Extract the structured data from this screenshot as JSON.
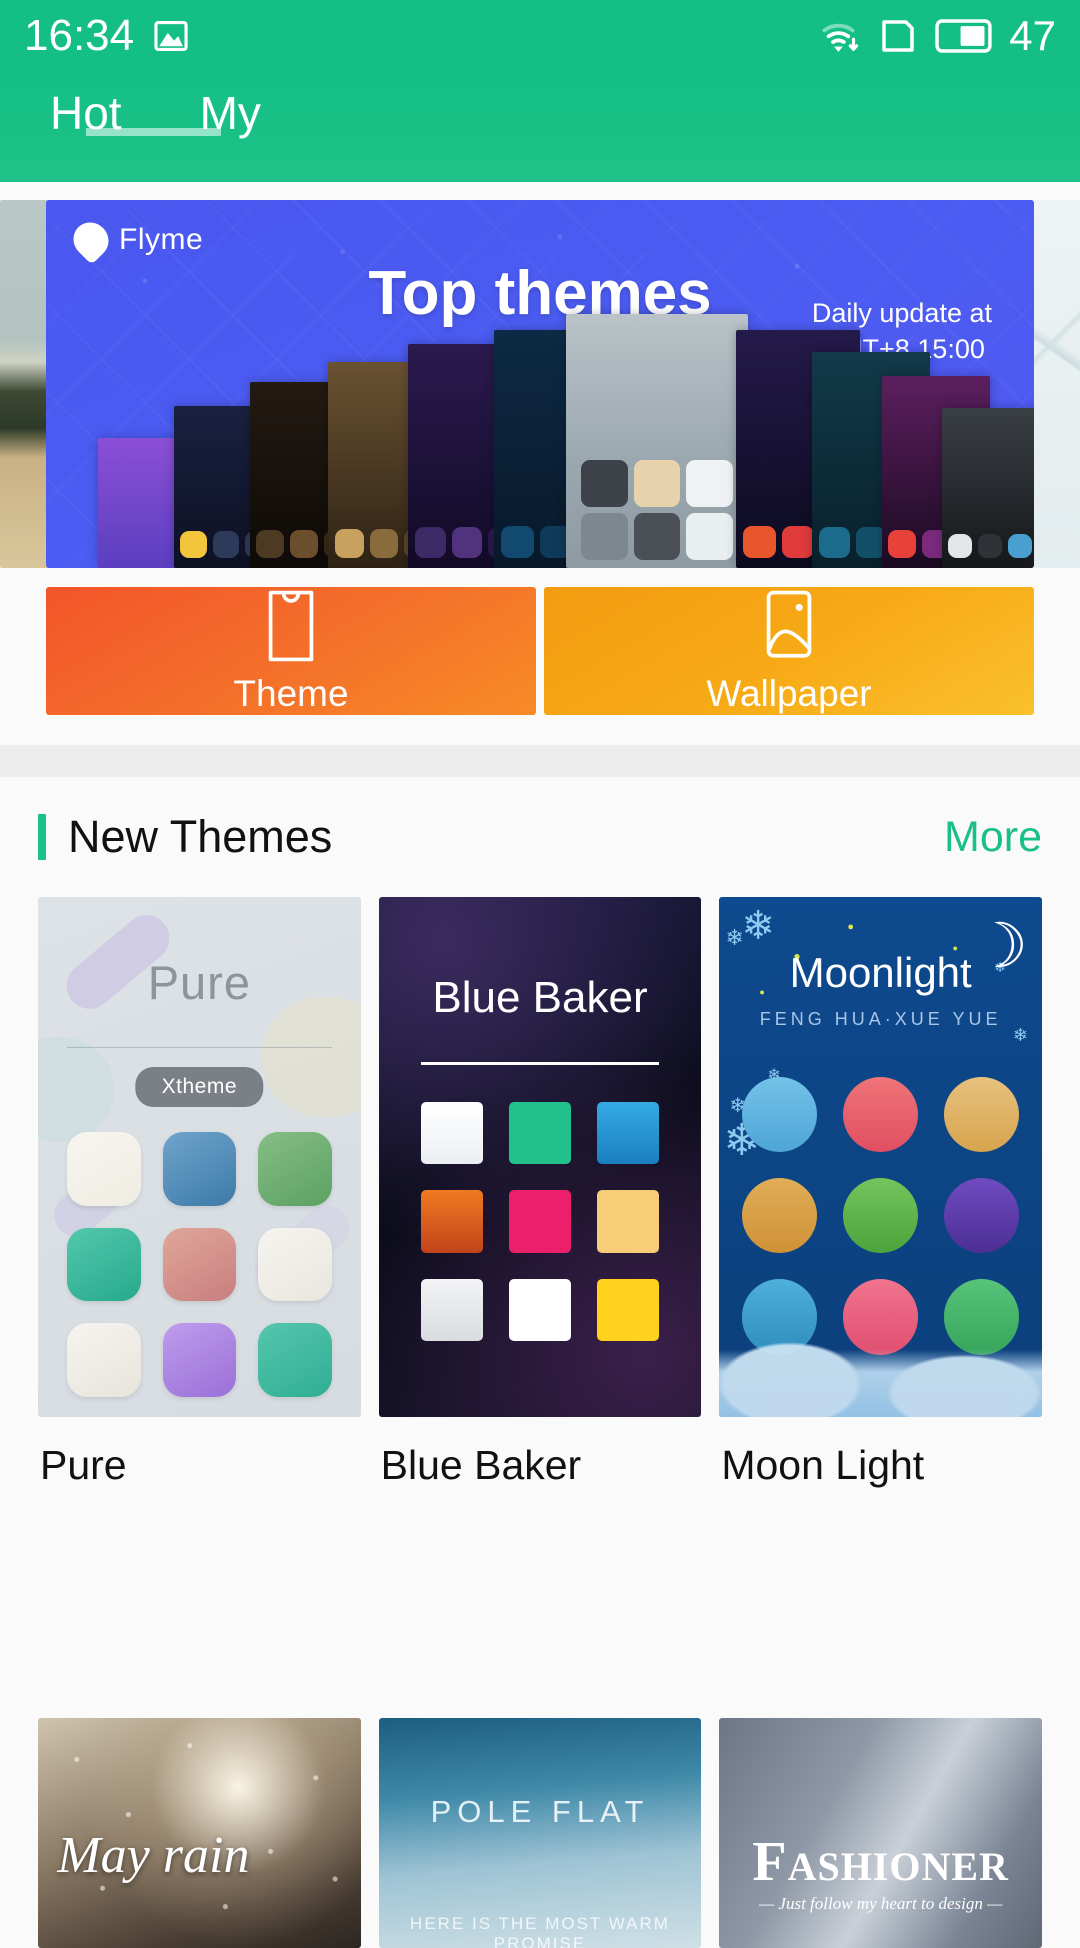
{
  "statusbar": {
    "time": "16:34",
    "battery_percent": "47",
    "icons": [
      "image-icon",
      "wifi-download-icon",
      "sim-card-icon",
      "battery-icon"
    ]
  },
  "tabs": [
    {
      "label": "Hot",
      "active": true
    },
    {
      "label": "My",
      "active": false
    }
  ],
  "banner": {
    "brand": "Flyme",
    "title": "Top themes",
    "note_line1": "Daily update at",
    "note_line2": "GMT+8 15:00",
    "chevron": "⌄",
    "background_color": "#4b5cf2"
  },
  "tiles": [
    {
      "label": "Theme",
      "icon": "tshirt-icon",
      "color": "#f4712a"
    },
    {
      "label": "Wallpaper",
      "icon": "picture-icon",
      "color": "#f7a915"
    }
  ],
  "section": {
    "title": "New Themes",
    "more_label": "More",
    "accent_color": "#19c08a"
  },
  "themes": [
    {
      "name": "Pure",
      "preview_title": "Pure",
      "preview_badge": "Xtheme",
      "icon_colors": [
        "#f4f2ec",
        "#4d87b5",
        "#6fab72",
        "#35b79a",
        "#d98c84",
        "#f2f0eb",
        "#f3f1ec",
        "#ae7ee0",
        "#3fb9a0"
      ]
    },
    {
      "name": "Blue Baker",
      "preview_title": "Blue Baker",
      "icon_colors": [
        "#f5f6f8",
        "#22c08a",
        "#2196d8",
        "#e8692a",
        "#ec1f6b",
        "#f7c86b",
        "#e9eaec",
        "#ffffff",
        "#ffd21e"
      ]
    },
    {
      "name": "Moon Light",
      "preview_title": "Moonlight",
      "preview_subtitle": "FENG HUA·XUE YUE",
      "icon_colors": [
        "#63b5e3",
        "#e8636c",
        "#e0b066",
        "#d9a23f",
        "#63b54a",
        "#5a3fa8",
        "#3fa8d6",
        "#e8607e",
        "#46b86e"
      ]
    }
  ],
  "wallpapers": [
    {
      "title": "May rain",
      "subtitle": ""
    },
    {
      "title": "POLE FLAT",
      "subtitle": "HERE IS THE MOST WARM PROMISE"
    },
    {
      "title_first": "F",
      "title_rest": "ASHIONER",
      "subtitle": "— Just follow my heart to design —"
    }
  ]
}
